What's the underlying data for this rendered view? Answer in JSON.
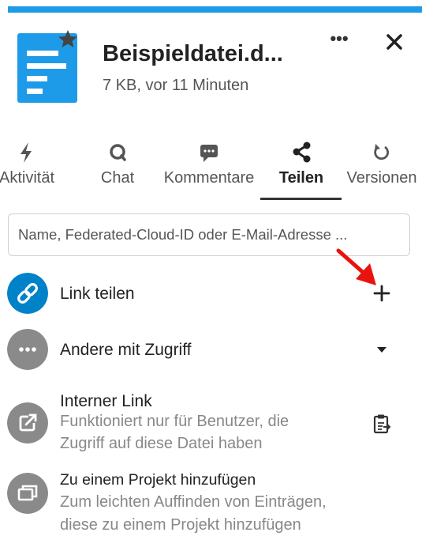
{
  "file": {
    "title": "Beispieldatei.d...",
    "meta": "7 KB, vor 11 Minuten",
    "icon": "document-icon",
    "favorite_icon": "star-icon",
    "more_label": "•••"
  },
  "tabs": [
    {
      "label": "Aktivität",
      "icon": "bolt-icon"
    },
    {
      "label": "Chat",
      "icon": "chat-icon"
    },
    {
      "label": "Kommentare",
      "icon": "comment-icon"
    },
    {
      "label": "Teilen",
      "icon": "share-icon",
      "active": true
    },
    {
      "label": "Versionen",
      "icon": "history-icon"
    }
  ],
  "search": {
    "placeholder": "Name, Federated-Cloud-ID oder E-Mail-Adresse ..."
  },
  "rows": {
    "link": {
      "label": "Link teilen",
      "icon": "link-icon",
      "action_icon": "plus-icon"
    },
    "others": {
      "label": "Andere mit Zugriff",
      "icon": "more-icon",
      "action_icon": "caret-down-icon"
    },
    "internal": {
      "label": "Interner Link",
      "sub1": "Funktioniert nur für Benutzer, die",
      "sub2": "Zugriff auf diese Datei haben",
      "icon": "external-link-icon",
      "action_icon": "clipboard-icon"
    },
    "project": {
      "label": "Zu einem Projekt hinzufügen",
      "sub1": "Zum leichten Auffinden von Einträgen,",
      "sub2": "diese zu einem Projekt hinzufügen",
      "icon": "project-icon"
    }
  },
  "colors": {
    "accent": "#1e9be8",
    "link_circle": "#0082c9",
    "grey_circle": "#8a8a8a",
    "annotation_arrow": "#e8130f"
  }
}
